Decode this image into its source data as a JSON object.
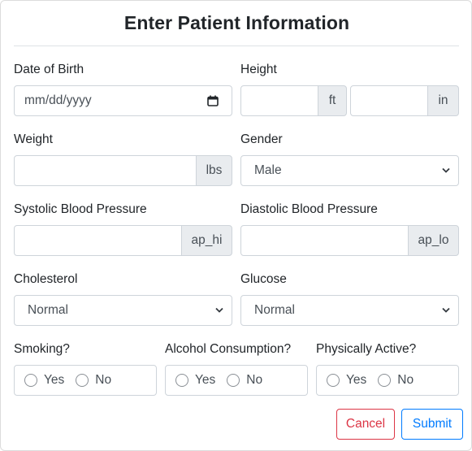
{
  "modal": {
    "title": "Enter Patient Information"
  },
  "fields": {
    "dob": {
      "label": "Date of Birth",
      "placeholder": "mm/dd/yyyy"
    },
    "height": {
      "label": "Height",
      "ft_unit": "ft",
      "in_unit": "in",
      "ft_value": "",
      "in_value": ""
    },
    "weight": {
      "label": "Weight",
      "unit": "lbs",
      "value": ""
    },
    "gender": {
      "label": "Gender",
      "selected": "Male"
    },
    "systolic": {
      "label": "Systolic Blood Pressure",
      "unit": "ap_hi",
      "value": ""
    },
    "diastolic": {
      "label": "Diastolic Blood Pressure",
      "unit": "ap_lo",
      "value": ""
    },
    "cholesterol": {
      "label": "Cholesterol",
      "selected": "Normal"
    },
    "glucose": {
      "label": "Glucose",
      "selected": "Normal"
    },
    "smoking": {
      "label": "Smoking?",
      "yes": "Yes",
      "no": "No"
    },
    "alcohol": {
      "label": "Alcohol Consumption?",
      "yes": "Yes",
      "no": "No"
    },
    "active": {
      "label": "Physically Active?",
      "yes": "Yes",
      "no": "No"
    }
  },
  "actions": {
    "cancel": "Cancel",
    "submit": "Submit"
  },
  "icons": {
    "calendar": "calendar-icon",
    "chevron": "chevron-down-icon"
  },
  "colors": {
    "cancel": "#dc3545",
    "submit": "#007bff",
    "addon_bg": "#e9ecef"
  }
}
